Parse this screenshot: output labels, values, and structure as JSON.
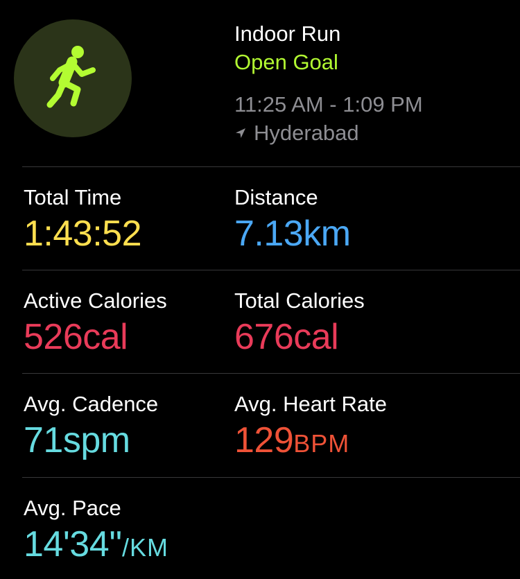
{
  "workout": {
    "title": "Indoor Run",
    "goal": "Open Goal",
    "time_range": "11:25 AM - 1:09 PM",
    "location": "Hyderabad",
    "icon": "running-figure-icon"
  },
  "metrics": {
    "total_time": {
      "label": "Total Time",
      "value": "1:43:52",
      "color": "#ffdf4f"
    },
    "distance": {
      "label": "Distance",
      "value": "7.13km",
      "color": "#4ba8f5"
    },
    "active_calories": {
      "label": "Active Calories",
      "value": "526cal",
      "color": "#e93b59"
    },
    "total_calories": {
      "label": "Total Calories",
      "value": "676cal",
      "color": "#e93b59"
    },
    "avg_cadence": {
      "label": "Avg. Cadence",
      "value": "71spm",
      "color": "#66dbe0"
    },
    "avg_heart_rate": {
      "label": "Avg. Heart Rate",
      "value": "129",
      "unit": "BPM",
      "color": "#ef5237"
    },
    "avg_pace": {
      "label": "Avg. Pace",
      "value": "14'34''",
      "unit": "/KM",
      "color": "#66dbe0"
    }
  },
  "colors": {
    "background": "#000000",
    "accent_green": "#b3fc32",
    "secondary_text": "#8e8e93",
    "divider": "#38383a"
  }
}
